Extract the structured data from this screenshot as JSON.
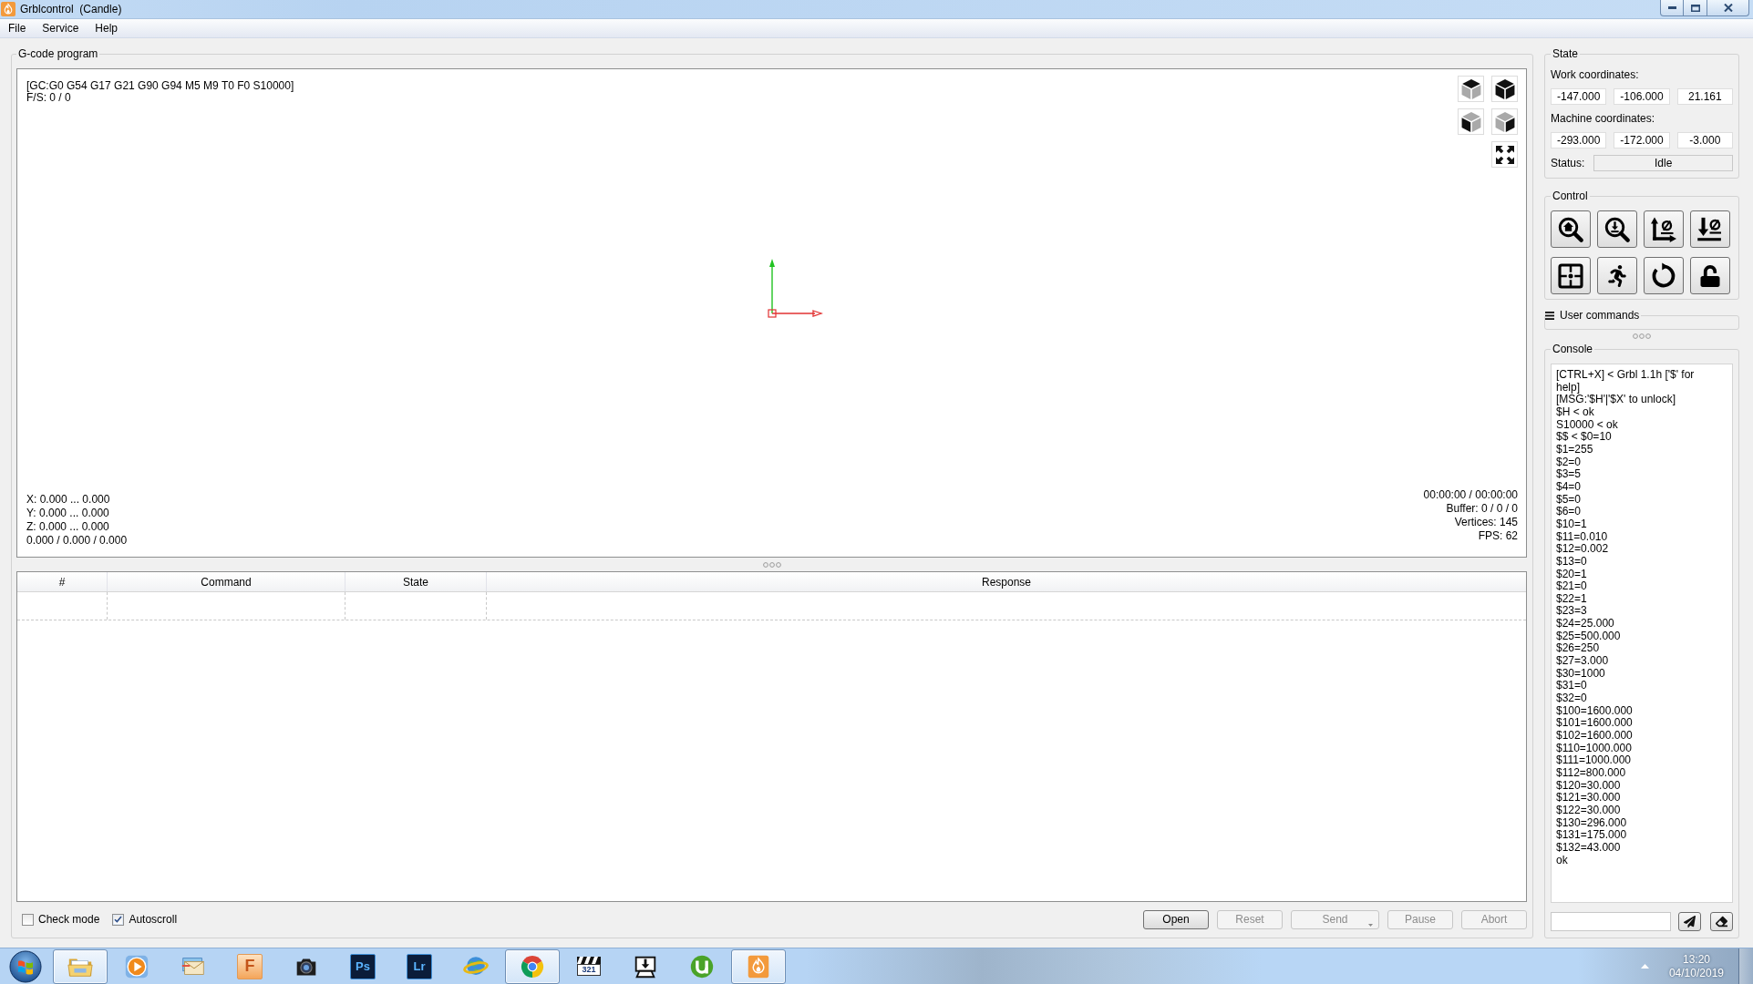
{
  "window": {
    "title": "Grblcontrol  (Candle)"
  },
  "menu": [
    "File",
    "Service",
    "Help"
  ],
  "gcode_program": {
    "title": "G-code program",
    "viewport": {
      "parser_state": "[GC:G0 G54 G17 G21 G90 G94 M5 M9 T0 F0 S10000]",
      "feed_spindle": "F/S: 0 / 0",
      "bounds": [
        "X: 0.000 ... 0.000",
        "Y: 0.000 ... 0.000",
        "Z: 0.000 ... 0.000",
        "0.000 / 0.000 / 0.000"
      ],
      "stats": [
        "00:00:00 / 00:00:00",
        "Buffer: 0 / 0 / 0",
        "Vertices: 145",
        "FPS: 62"
      ]
    },
    "table": {
      "columns": [
        "#",
        "Command",
        "State",
        "Response"
      ]
    },
    "options": [
      {
        "label": "Check mode",
        "checked": false
      },
      {
        "label": "Autoscroll",
        "checked": true
      }
    ],
    "buttons": [
      {
        "label": "Open",
        "kind": "push",
        "disabled": false
      },
      {
        "label": "Reset",
        "kind": "push",
        "disabled": true
      },
      {
        "label": "Send",
        "kind": "menu",
        "disabled": true
      },
      {
        "label": "Pause",
        "kind": "push",
        "disabled": true
      },
      {
        "label": "Abort",
        "kind": "push",
        "disabled": true
      }
    ]
  },
  "state": {
    "title": "State",
    "work_label": "Work coordinates:",
    "work": [
      "-147.000",
      "-106.000",
      "21.161"
    ],
    "machine_label": "Machine coordinates:",
    "machine": [
      "-293.000",
      "-172.000",
      "-3.000"
    ],
    "status_label": "Status:",
    "status": "Idle"
  },
  "control": {
    "title": "Control"
  },
  "user_commands": {
    "title": "User commands"
  },
  "console": {
    "title": "Console",
    "lines": [
      "[CTRL+X] < Grbl 1.1h ['$' for help]",
      "[MSG:'$H'|'$X' to unlock]",
      "$H < ok",
      "S10000 < ok",
      "$$ < $0=10",
      "$1=255",
      "$2=0",
      "$3=5",
      "$4=0",
      "$5=0",
      "$6=0",
      "$10=1",
      "$11=0.010",
      "$12=0.002",
      "$13=0",
      "$20=1",
      "$21=0",
      "$22=1",
      "$23=3",
      "$24=25.000",
      "$25=500.000",
      "$26=250",
      "$27=3.000",
      "$30=1000",
      "$31=0",
      "$32=0",
      "$100=1600.000",
      "$101=1600.000",
      "$102=1600.000",
      "$110=1000.000",
      "$111=1000.000",
      "$112=800.000",
      "$120=30.000",
      "$121=30.000",
      "$122=30.000",
      "$130=296.000",
      "$131=175.000",
      "$132=43.000",
      "ok"
    ]
  },
  "taskbar": {
    "items": [
      {
        "kind": "folder",
        "running": true
      },
      {
        "kind": "player",
        "running": false
      },
      {
        "kind": "mail",
        "running": false
      },
      {
        "kind": "orangetile",
        "label": "F",
        "running": false
      },
      {
        "kind": "camera",
        "running": false
      },
      {
        "kind": "navytile",
        "label": "Ps",
        "running": false
      },
      {
        "kind": "navytile",
        "label": "Lr",
        "running": false
      },
      {
        "kind": "globe",
        "running": false
      },
      {
        "kind": "ringlogo",
        "running": true
      },
      {
        "kind": "clapper",
        "label": "321",
        "running": false
      },
      {
        "kind": "installer",
        "running": false
      },
      {
        "kind": "ulogo",
        "running": false
      },
      {
        "kind": "flame",
        "running": true
      }
    ],
    "clock": {
      "time": "13:20",
      "date": "04/10/2019"
    }
  }
}
